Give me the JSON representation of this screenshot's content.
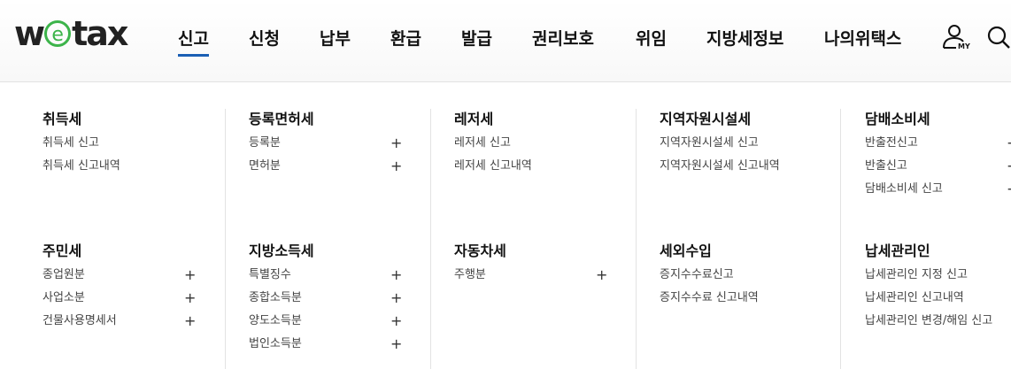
{
  "brand": {
    "logo_w": "w",
    "logo_e": "e",
    "logo_rest": "tax"
  },
  "nav": {
    "items": [
      "신고",
      "신청",
      "납부",
      "환급",
      "발급",
      "권리보호",
      "위임",
      "지방세정보",
      "나의위택스"
    ],
    "active_index": 0,
    "my_label": "MY"
  },
  "colors": {
    "accent": "#1a5fb4",
    "logo_green": "#3cb44a"
  },
  "menu": {
    "columns": [
      {
        "groups": [
          {
            "title": "취득세",
            "items": [
              {
                "label": "취득세 신고",
                "plus": false
              },
              {
                "label": "취득세 신고내역",
                "plus": false
              }
            ]
          },
          {
            "title": "주민세",
            "items": [
              {
                "label": "종업원분",
                "plus": true
              },
              {
                "label": "사업소분",
                "plus": true
              },
              {
                "label": "건물사용명세서",
                "plus": true
              }
            ]
          }
        ]
      },
      {
        "groups": [
          {
            "title": "등록면허세",
            "items": [
              {
                "label": "등록분",
                "plus": true
              },
              {
                "label": "면허분",
                "plus": true
              }
            ]
          },
          {
            "title": "지방소득세",
            "items": [
              {
                "label": "특별징수",
                "plus": true
              },
              {
                "label": "종합소득분",
                "plus": true
              },
              {
                "label": "양도소득분",
                "plus": true
              },
              {
                "label": "법인소득분",
                "plus": true
              }
            ]
          }
        ]
      },
      {
        "groups": [
          {
            "title": "레저세",
            "items": [
              {
                "label": "레저세 신고",
                "plus": false
              },
              {
                "label": "레저세 신고내역",
                "plus": false
              }
            ]
          },
          {
            "title": "자동차세",
            "items": [
              {
                "label": "주행분",
                "plus": true
              }
            ]
          }
        ]
      },
      {
        "groups": [
          {
            "title": "지역자원시설세",
            "items": [
              {
                "label": "지역자원시설세 신고",
                "plus": false
              },
              {
                "label": "지역자원시설세 신고내역",
                "plus": false
              }
            ]
          },
          {
            "title": "세외수입",
            "items": [
              {
                "label": "증지수수료신고",
                "plus": false
              },
              {
                "label": "증지수수료 신고내역",
                "plus": false
              }
            ]
          }
        ]
      },
      {
        "groups": [
          {
            "title": "담배소비세",
            "items": [
              {
                "label": "반출전신고",
                "plus": true
              },
              {
                "label": "반출신고",
                "plus": true
              },
              {
                "label": "담배소비세 신고",
                "plus": true
              }
            ]
          },
          {
            "title": "납세관리인",
            "items": [
              {
                "label": "납세관리인 지정 신고",
                "plus": false
              },
              {
                "label": "납세관리인 신고내역",
                "plus": false
              },
              {
                "label": "납세관리인 변경/해임 신고",
                "plus": false
              }
            ]
          }
        ]
      }
    ]
  }
}
